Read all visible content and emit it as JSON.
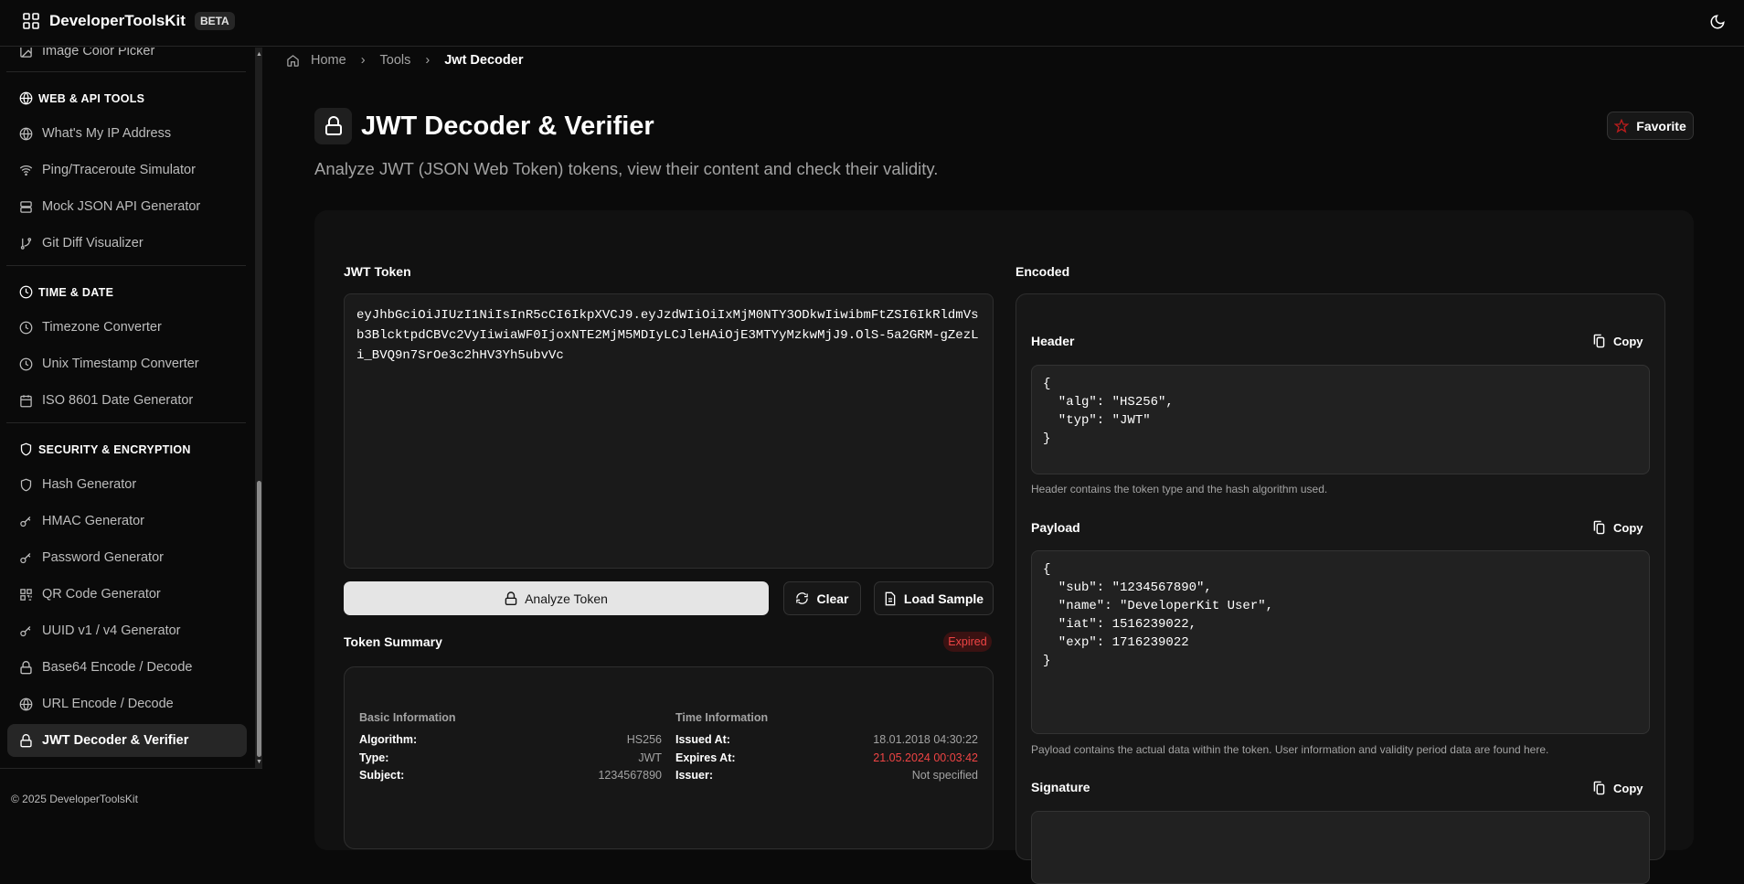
{
  "app": {
    "name": "DeveloperToolsKit",
    "badge": "BETA"
  },
  "sidebar": {
    "top_item": "Image Color Picker",
    "sections": [
      {
        "title": "WEB & API TOOLS",
        "items": [
          "What's My IP Address",
          "Ping/Traceroute Simulator",
          "Mock JSON API Generator",
          "Git Diff Visualizer"
        ]
      },
      {
        "title": "TIME & DATE",
        "items": [
          "Timezone Converter",
          "Unix Timestamp Converter",
          "ISO 8601 Date Generator"
        ]
      },
      {
        "title": "SECURITY & ENCRYPTION",
        "items": [
          "Hash Generator",
          "HMAC Generator",
          "Password Generator",
          "QR Code Generator",
          "UUID v1 / v4 Generator",
          "Base64 Encode / Decode",
          "URL Encode / Decode",
          "JWT Decoder & Verifier"
        ]
      }
    ],
    "footer": "© 2025 DeveloperToolsKit"
  },
  "breadcrumb": [
    "Home",
    "Tools",
    "Jwt Decoder"
  ],
  "page": {
    "title": "JWT Decoder & Verifier",
    "subtitle": "Analyze JWT (JSON Web Token) tokens, view their content and check their validity.",
    "favorite": "Favorite"
  },
  "input": {
    "label": "JWT Token",
    "value": "eyJhbGciOiJIUzI1NiIsInR5cCI6IkpXVCJ9.eyJzdWIiOiIxMjM0NTY3ODkwIiwibmFtZSI6IkRldmVsb3BlcktpdCBVc2VyIiwiaWF0IjoxNTE2MjM5MDIyLCJleHAiOjE3MTYyMzkwMjJ9.OlS-5a2GRM-gZezLi_BVQ9n7SrOe3c2hHV3Yh5ubvVc"
  },
  "buttons": {
    "analyze": "Analyze Token",
    "clear": "Clear",
    "load_sample": "Load Sample"
  },
  "summary": {
    "title": "Token Summary",
    "status": "Expired",
    "basic": {
      "title": "Basic Information",
      "rows": [
        [
          "Algorithm:",
          "HS256"
        ],
        [
          "Type:",
          "JWT"
        ],
        [
          "Subject:",
          "1234567890"
        ]
      ]
    },
    "time": {
      "title": "Time Information",
      "rows": [
        [
          "Issued At:",
          "18.01.2018 04:30:22"
        ],
        [
          "Expires At:",
          "21.05.2024 00:03:42"
        ],
        [
          "Issuer:",
          "Not specified"
        ]
      ]
    }
  },
  "encoded": {
    "label": "Encoded",
    "copy": "Copy",
    "header": {
      "label": "Header",
      "code": "{\n  \"alg\": \"HS256\",\n  \"typ\": \"JWT\"\n}",
      "help": "Header contains the token type and the hash algorithm used."
    },
    "payload": {
      "label": "Payload",
      "code": "{\n  \"sub\": \"1234567890\",\n  \"name\": \"DeveloperKit User\",\n  \"iat\": 1516239022,\n  \"exp\": 1716239022\n}",
      "help": "Payload contains the actual data within the token. User information and validity period data are found here."
    },
    "signature": {
      "label": "Signature"
    }
  },
  "colors": {
    "accent_red": "#ef4444",
    "bg": "#0a0a0a"
  }
}
